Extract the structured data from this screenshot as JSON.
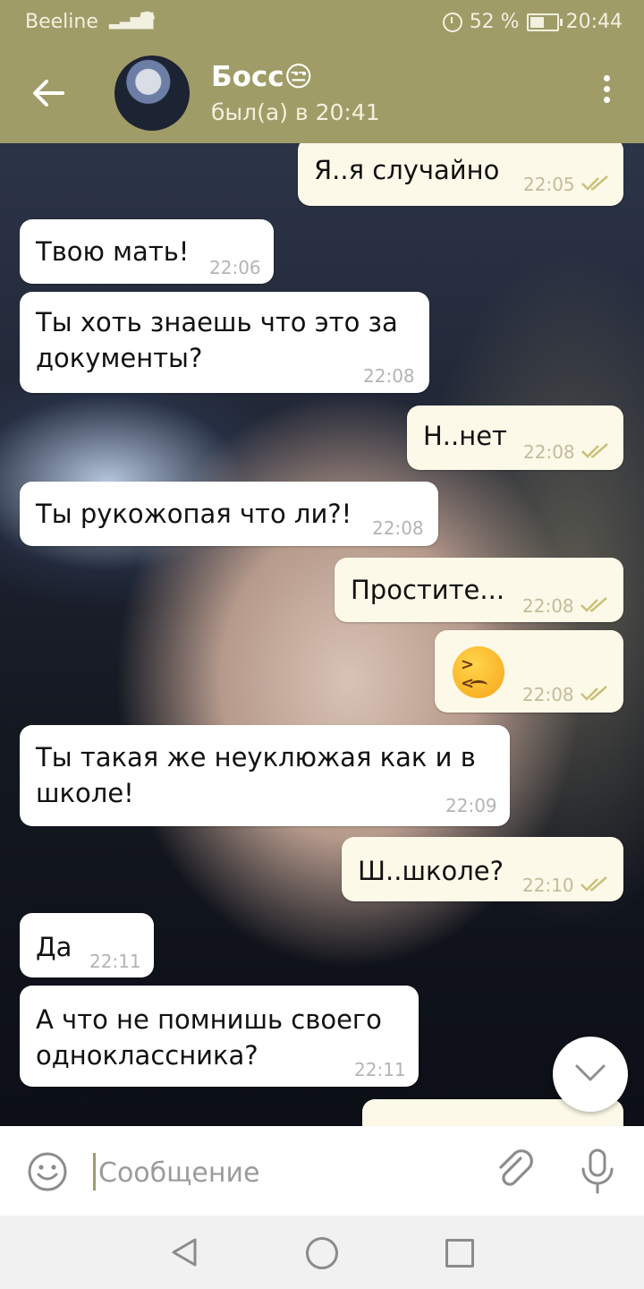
{
  "status_bar": {
    "carrier": "Beeline",
    "battery": "52 %",
    "battery_level": 0.52,
    "time": "20:44"
  },
  "header": {
    "name": "Босс😒",
    "status": "был(а) в 20:41"
  },
  "messages": [
    {
      "text": "Я..я случайно",
      "time": "22:05"
    },
    {
      "text": "Твою мать!",
      "time": "22:06"
    },
    {
      "text": "Ты хоть знаешь что это за\nдокументы?",
      "time": "22:08"
    },
    {
      "text": "Н..нет",
      "time": "22:08"
    },
    {
      "text": "Ты рукожопая что ли?!",
      "time": "22:08"
    },
    {
      "text": "Простите...",
      "time": "22:08"
    },
    {
      "emoji": "persevering-face",
      "time": "22:08"
    },
    {
      "text": "Ты такая же неуклюжая как и в\nшколе!",
      "time": "22:09"
    },
    {
      "text": "Ш..школе?",
      "time": "22:10"
    },
    {
      "text": "Да",
      "time": "22:11"
    },
    {
      "text": "А что не помнишь своего\nодноклассника?",
      "time": "22:11"
    }
  ],
  "input": {
    "placeholder": "Сообщение"
  },
  "colors": {
    "header": "#a09c68",
    "incoming": "#ffffff",
    "outgoing": "#fdf9e8",
    "read_check": "#c9c07a"
  },
  "icons": [
    "back-arrow-icon",
    "more-vert-icon",
    "double-check-icon",
    "chevron-down-icon",
    "smile-icon",
    "paperclip-icon",
    "mic-icon",
    "nav-back-icon",
    "nav-home-icon",
    "nav-recent-icon"
  ]
}
